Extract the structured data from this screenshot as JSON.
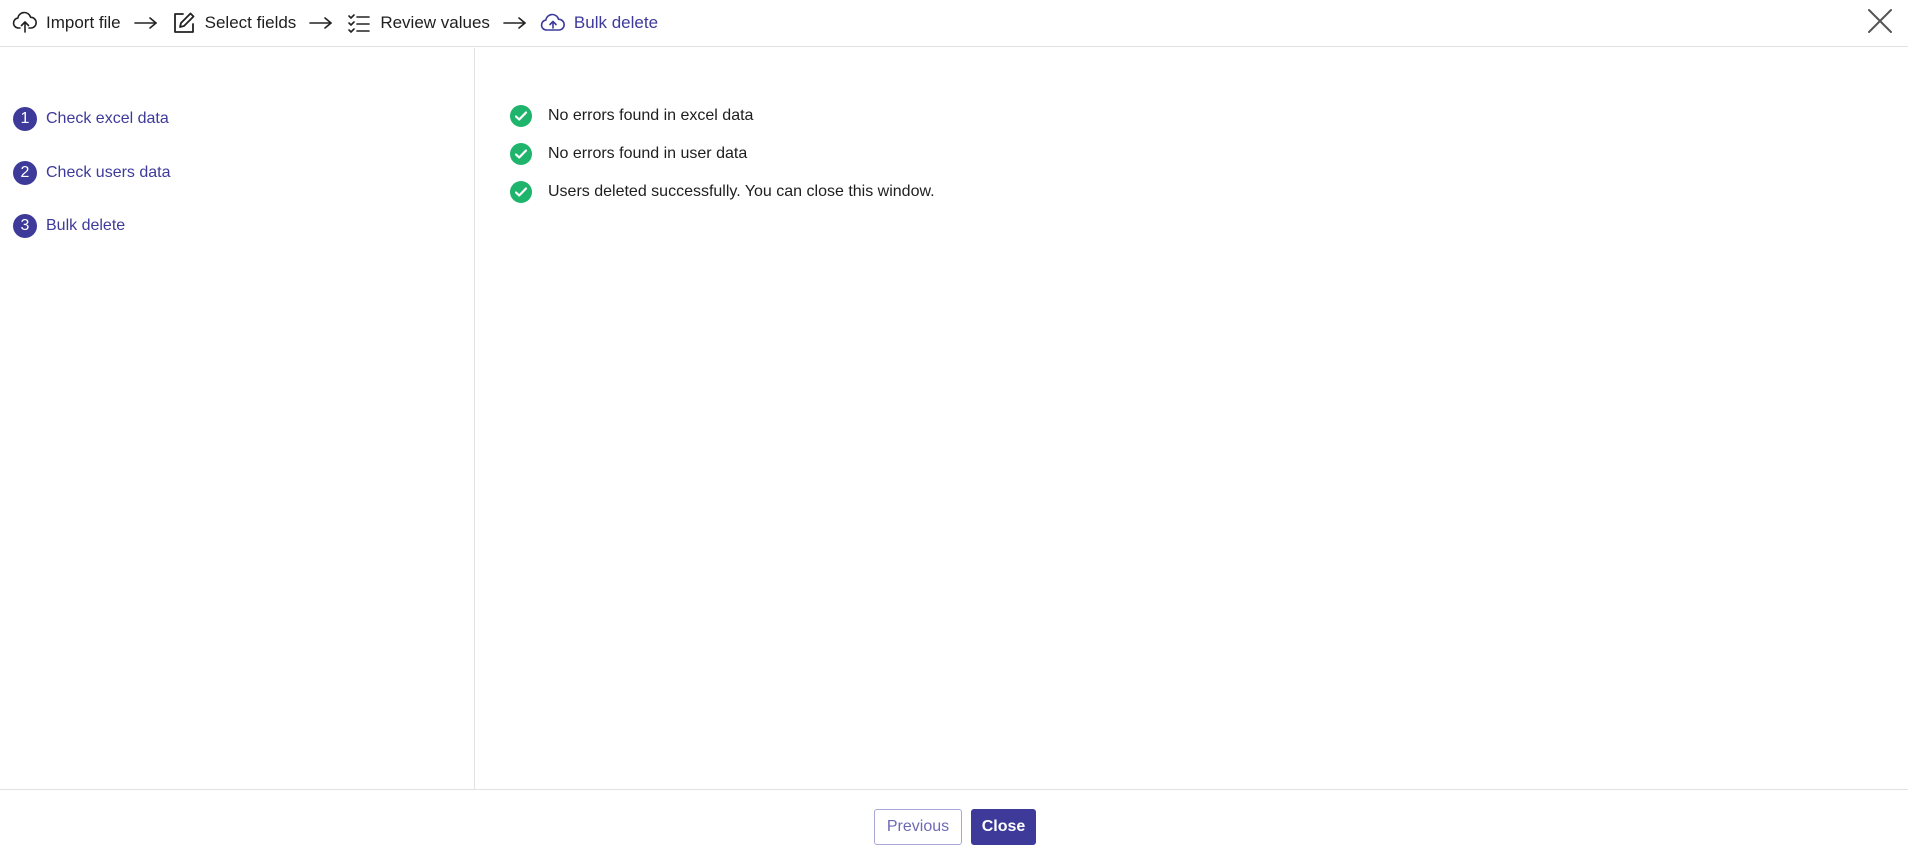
{
  "wizard": {
    "steps": [
      {
        "label": "Import file",
        "icon": "cloud-upload-icon"
      },
      {
        "label": "Select fields",
        "icon": "edit-icon"
      },
      {
        "label": "Review values",
        "icon": "checklist-icon"
      },
      {
        "label": "Bulk delete",
        "icon": "cloud-upload-icon"
      }
    ],
    "active_step": 3
  },
  "sidebar": {
    "items": [
      {
        "number": "1",
        "label": "Check excel data"
      },
      {
        "number": "2",
        "label": "Check users data"
      },
      {
        "number": "3",
        "label": "Bulk delete"
      }
    ]
  },
  "messages": [
    {
      "text": "No errors found in excel data",
      "status": "success"
    },
    {
      "text": "No errors found in user data",
      "status": "success"
    },
    {
      "text": "Users deleted successfully. You can close this window.",
      "status": "success"
    }
  ],
  "footer": {
    "previous_label": "Previous",
    "close_label": "Close"
  },
  "colors": {
    "accent": "#3d3a9a",
    "success": "#1fb46c"
  }
}
